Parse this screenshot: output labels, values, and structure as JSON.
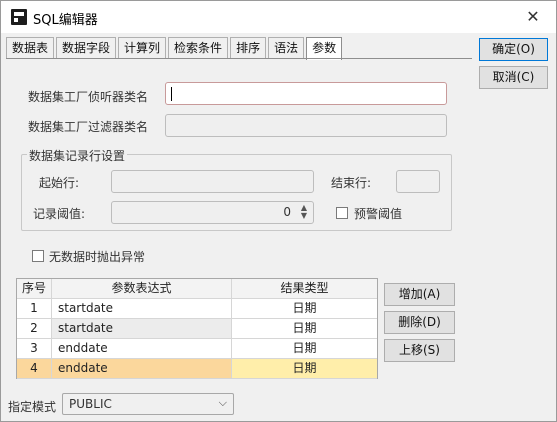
{
  "window": {
    "title": "SQL编辑器",
    "close_glyph": "✕"
  },
  "tabs": [
    {
      "label": "数据表",
      "active": false
    },
    {
      "label": "数据字段",
      "active": false
    },
    {
      "label": "计算列",
      "active": false
    },
    {
      "label": "检索条件",
      "active": false
    },
    {
      "label": "排序",
      "active": false
    },
    {
      "label": "语法",
      "active": false
    },
    {
      "label": "参数",
      "active": true
    }
  ],
  "dialog_buttons": {
    "ok_label": "确定(O)",
    "cancel_label": "取消(C)"
  },
  "form": {
    "listener_label": "数据集工厂侦听器类名",
    "listener_value": "",
    "filter_label": "数据集工厂过滤器类名",
    "filter_value": ""
  },
  "record_settings": {
    "group_title": "数据集记录行设置",
    "start_row_label": "起始行:",
    "start_row_value": "",
    "end_row_label": "结束行:",
    "end_row_value": "",
    "threshold_label": "记录阈值:",
    "threshold_value": "0",
    "warn_threshold_label": "预警阈值",
    "warn_threshold_checked": false
  },
  "no_data_exception": {
    "label": "无数据时抛出异常",
    "checked": false
  },
  "params_table": {
    "headers": [
      "序号",
      "参数表达式",
      "结果类型"
    ],
    "rows": [
      {
        "index": "1",
        "expression": "startdate",
        "type": "日期"
      },
      {
        "index": "2",
        "expression": "startdate",
        "type": "日期"
      },
      {
        "index": "3",
        "expression": "enddate",
        "type": "日期"
      },
      {
        "index": "4",
        "expression": "enddate",
        "type": "日期"
      }
    ],
    "selected_row": 4
  },
  "table_buttons": {
    "add_label": "增加(A)",
    "delete_label": "删除(D)",
    "up_label": "上移(S)"
  },
  "schema": {
    "label": "指定模式",
    "value": "PUBLIC"
  },
  "colors": {
    "selected_row": "#ffeeaa",
    "focus_border": "#0078d7"
  }
}
